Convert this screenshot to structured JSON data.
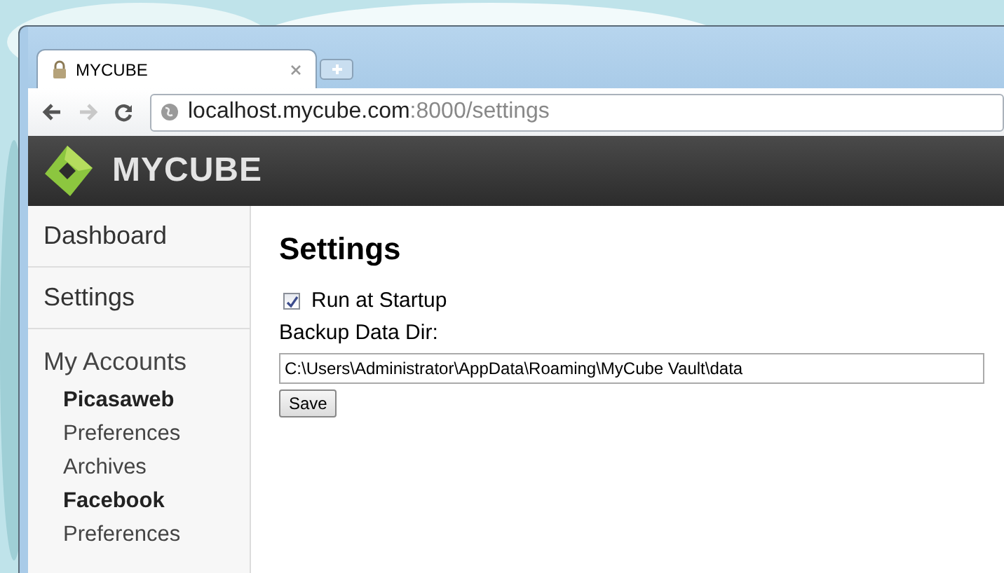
{
  "browser": {
    "tab": {
      "title": "MYCUBE"
    },
    "address": {
      "host": "localhost.mycube.com",
      "rest": ":8000/settings"
    }
  },
  "header": {
    "logo_text": "MYCUBE"
  },
  "sidebar": {
    "items": [
      {
        "label": "Dashboard"
      },
      {
        "label": "Settings"
      }
    ],
    "accounts": {
      "title": "My Accounts",
      "items": [
        {
          "label": "Picasaweb",
          "kind": "account"
        },
        {
          "label": "Preferences",
          "kind": "link"
        },
        {
          "label": "Archives",
          "kind": "link"
        },
        {
          "label": "Facebook",
          "kind": "account"
        },
        {
          "label": "Preferences",
          "kind": "link"
        }
      ]
    }
  },
  "main": {
    "title": "Settings",
    "run_at_startup": {
      "label": "Run at Startup",
      "checked": true
    },
    "backup_dir": {
      "label": "Backup Data Dir:",
      "value": "C:\\Users\\Administrator\\AppData\\Roaming\\MyCube Vault\\data"
    },
    "save_button": "Save"
  }
}
